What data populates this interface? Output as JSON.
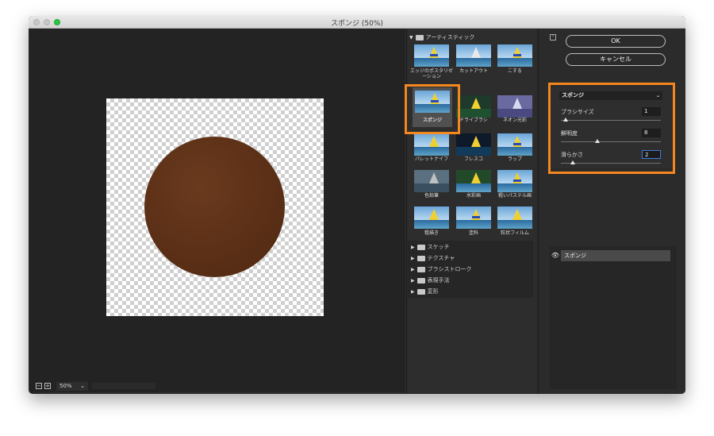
{
  "window": {
    "title": "スポンジ (50%)"
  },
  "preview": {
    "zoom": "50%",
    "zoom_out_label": "−",
    "zoom_in_label": "+"
  },
  "gallery": {
    "top_category": "アーティスティック",
    "filters": [
      {
        "label": "エッジのポスタリゼーション"
      },
      {
        "label": "カットアウト"
      },
      {
        "label": "こする"
      },
      {
        "label": "スポンジ"
      },
      {
        "label": "ドライブラシ"
      },
      {
        "label": "ネオン光彩"
      },
      {
        "label": "パレットナイフ"
      },
      {
        "label": "フレスコ"
      },
      {
        "label": "ラップ"
      },
      {
        "label": "色鉛筆"
      },
      {
        "label": "水彩画"
      },
      {
        "label": "粗いパステル画"
      },
      {
        "label": "粗描き"
      },
      {
        "label": "塗料"
      },
      {
        "label": "粒状フィルム"
      }
    ],
    "selected_filter": "スポンジ",
    "other_categories": [
      "スケッチ",
      "テクスチャ",
      "ブラシストローク",
      "表現手法",
      "変形"
    ]
  },
  "buttons": {
    "ok": "OK",
    "cancel": "キャンセル"
  },
  "params": {
    "filter_name": "スポンジ",
    "brush_size_label": "ブラシサイズ",
    "brush_size_value": "1",
    "brush_size_fraction": 0.0,
    "definition_label": "鮮明度",
    "definition_value": "8",
    "definition_fraction": 0.32,
    "smoothness_label": "滑らかさ",
    "smoothness_value": "2",
    "smoothness_fraction": 0.07
  },
  "layers": {
    "items": [
      {
        "name": "スポンジ"
      }
    ]
  },
  "colors": {
    "highlight": "#f5871f",
    "accent": "#3f7be0",
    "circle": "#5a2f16"
  }
}
